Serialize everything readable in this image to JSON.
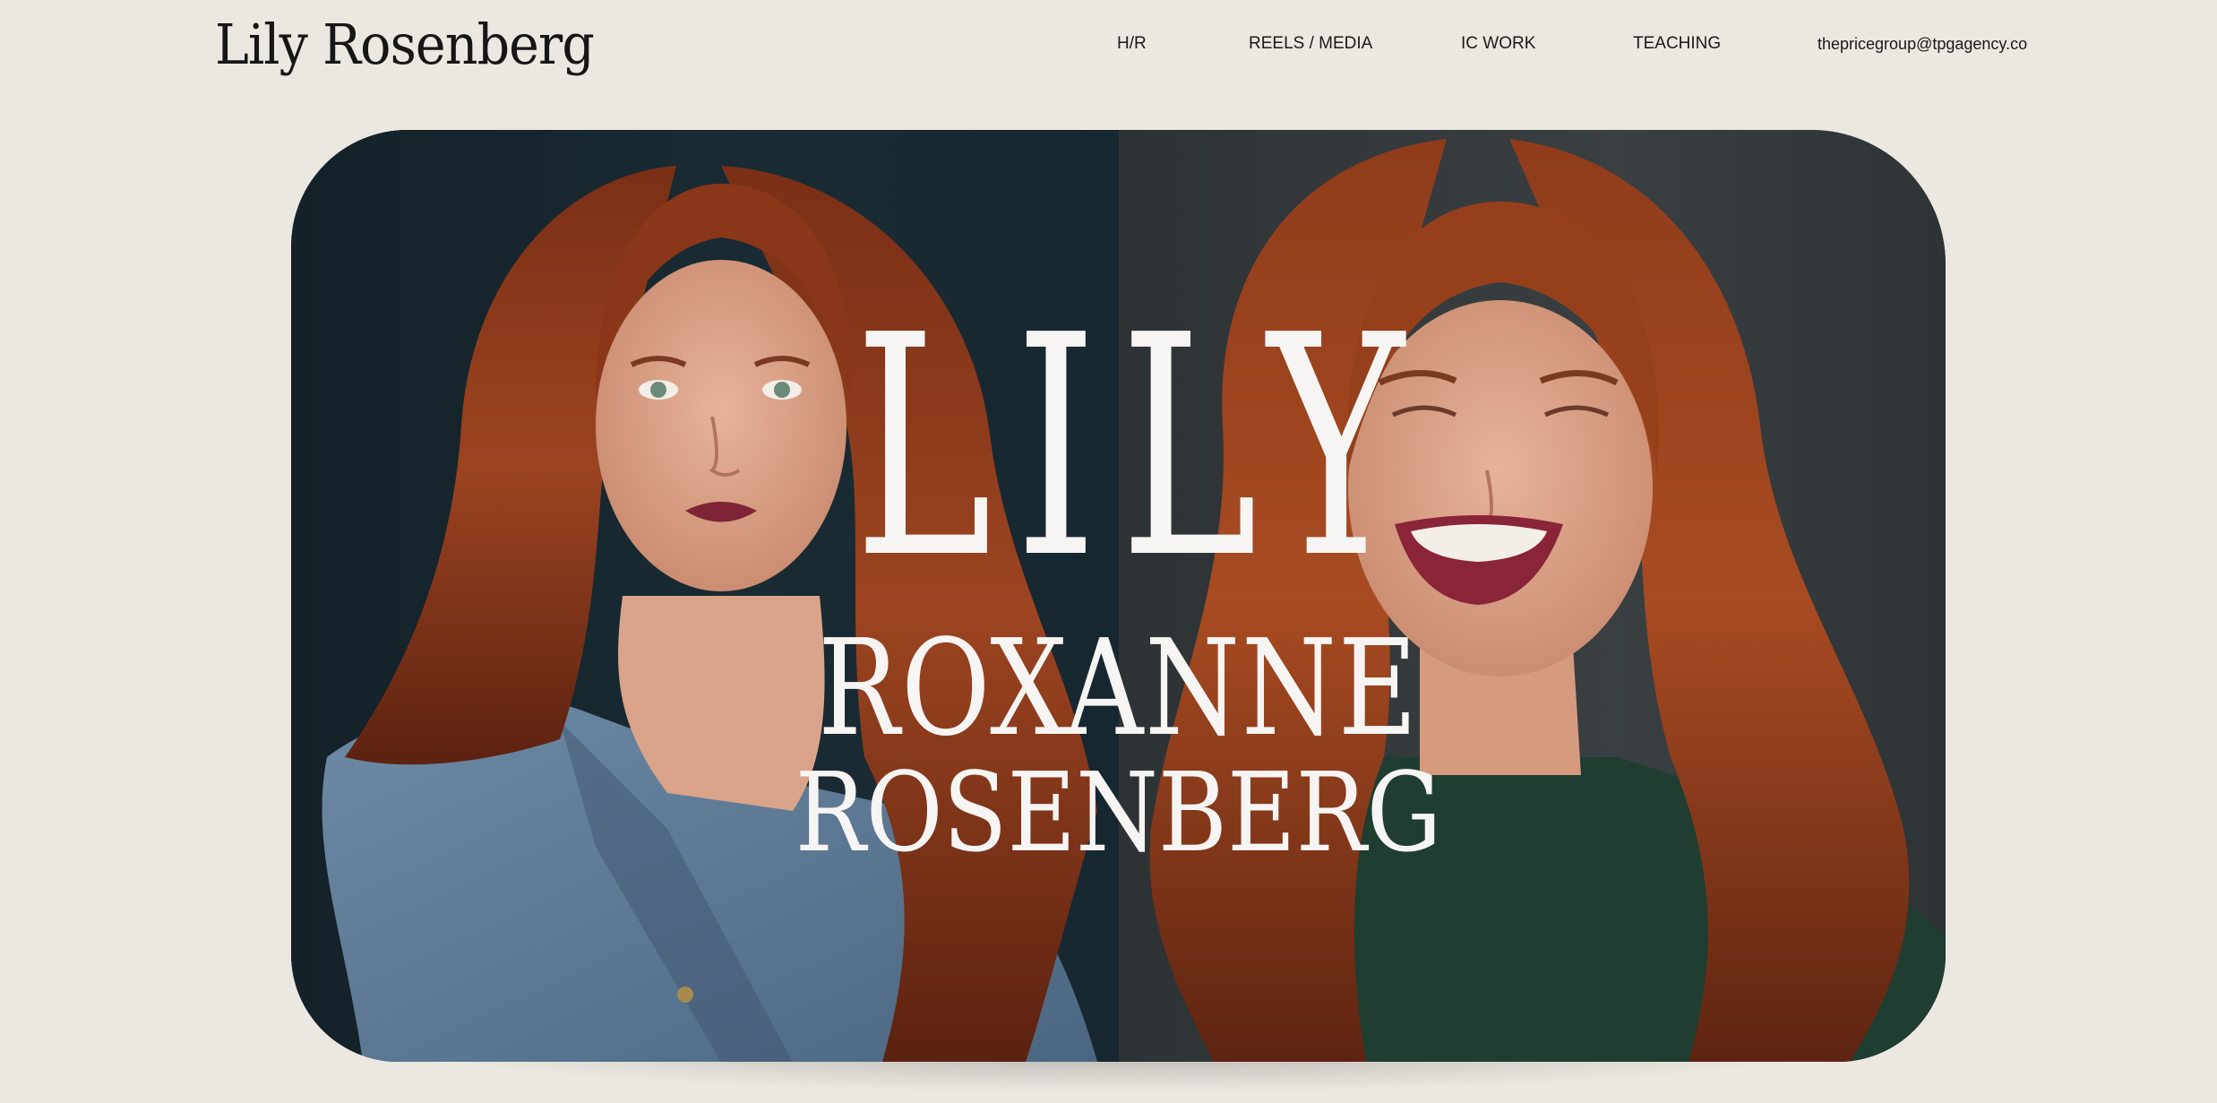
{
  "header": {
    "logo_text": "Lily Rosenberg",
    "nav": {
      "hr": "H/R",
      "reels_media": "REELS / MEDIA",
      "ic_work": "IC WORK",
      "teaching": "TEACHING",
      "email": "thepricegroup@tpgagency.co"
    }
  },
  "hero": {
    "first_name": "LILY",
    "middle_name": "ROXANNE",
    "last_name": "ROSENBERG"
  },
  "colors": {
    "page_background": "#ebe7e1",
    "text_dark": "#161616",
    "hero_text": "#f6f5f3",
    "hair": "#8e3a1c",
    "denim": "#5f7d9c",
    "sweater": "#1f3d30"
  },
  "icons": {}
}
